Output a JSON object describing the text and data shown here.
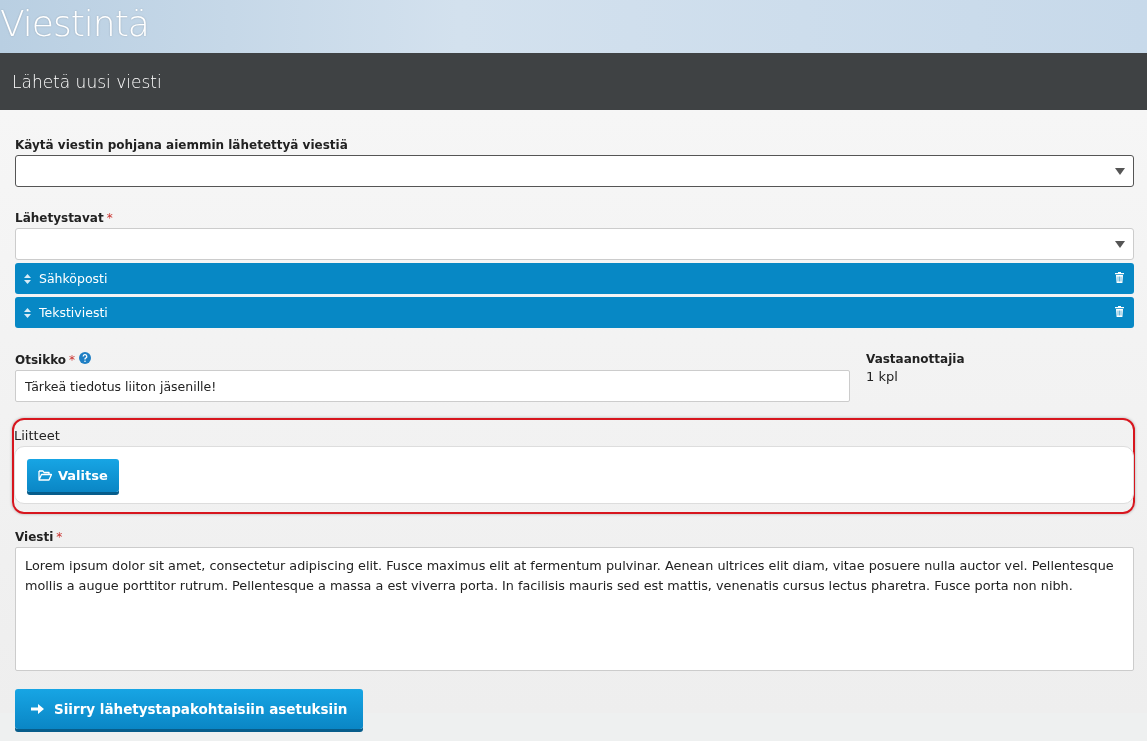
{
  "page_title": "Viestintä",
  "panel_title": "Lähetä uusi viesti",
  "template_select": {
    "label": "Käytä viestin pohjana aiemmin lähetettyä viestiä"
  },
  "send_methods": {
    "label": "Lähetystavat",
    "required_mark": "*",
    "selected_items": [
      "Sähköposti",
      "Tekstiviesti"
    ]
  },
  "subject": {
    "label": "Otsikko",
    "required_mark": "*",
    "value": "Tärkeä tiedotus liiton jäsenille!"
  },
  "recipients": {
    "label": "Vastaanottajia",
    "count": "1 kpl"
  },
  "attachments": {
    "label": "Liitteet",
    "highlighted": true,
    "button": "Valitse"
  },
  "message": {
    "label": "Viesti",
    "required_mark": "*",
    "value": "Lorem ipsum dolor sit amet, consectetur adipiscing elit. Fusce maximus elit at fermentum pulvinar. Aenean ultrices elit diam, vitae posuere nulla auctor vel. Pellentesque mollis a augue porttitor rutrum. Pellentesque a massa a est viverra porta. In facilisis mauris sed est mattis, venenatis cursus lectus pharetra. Fusce porta non nibh."
  },
  "next_button": "Siirry lähetystapakohtaisiin asetuksiin"
}
